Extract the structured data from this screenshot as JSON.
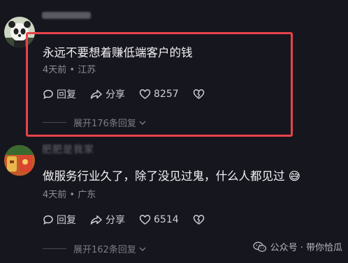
{
  "comments": [
    {
      "text": "永远不要想着赚低端客户的钱",
      "time": "4天前",
      "location": "江苏",
      "reply_label": "回复",
      "share_label": "分享",
      "likes": "8257",
      "more_replies": "展开176条回复"
    },
    {
      "username": "肥肥是我家",
      "text": "做服务行业久了，除了没见过鬼，什么人都见过",
      "emoji": "😅",
      "time": "4天前",
      "location": "广东",
      "reply_label": "回复",
      "share_label": "分享",
      "likes": "6514",
      "more_replies": "展开162条回复"
    }
  ],
  "meta_separator": "•",
  "watermark": {
    "label": "公众号 · 带你恰瓜"
  },
  "colors": {
    "highlight": "#e8434a",
    "background": "#16161e"
  },
  "icons": [
    "panda-avatar",
    "food-avatar",
    "reply-icon",
    "share-icon",
    "heart-icon",
    "broken-heart-icon",
    "chevron-down-icon",
    "wechat-icon"
  ]
}
